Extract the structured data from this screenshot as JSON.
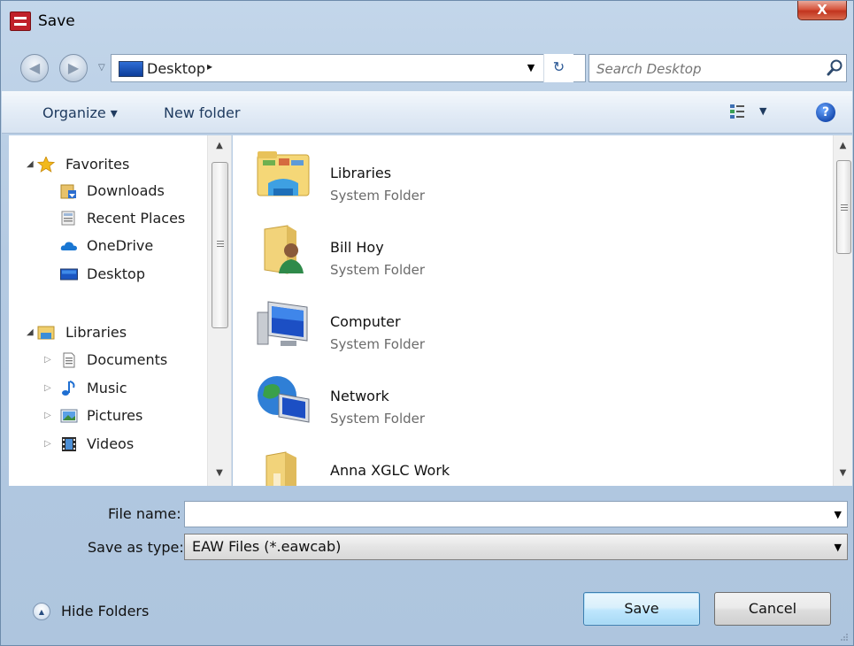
{
  "window": {
    "title": "Save",
    "close_label": "X"
  },
  "address": {
    "location": "Desktop",
    "separator": "▸",
    "back_glyph": "◀",
    "forward_glyph": "▶",
    "refresh_glyph": "↻"
  },
  "search": {
    "placeholder": "Search Desktop"
  },
  "toolbar": {
    "organize_label": "Organize ▾",
    "new_folder_label": "New folder",
    "view_caret": "▼",
    "help_label": "?"
  },
  "nav": {
    "favorites": {
      "label": "Favorites",
      "items": [
        {
          "label": "Downloads",
          "icon": "downloads-icon"
        },
        {
          "label": "Recent Places",
          "icon": "recent-places-icon"
        },
        {
          "label": "OneDrive",
          "icon": "onedrive-icon"
        },
        {
          "label": "Desktop",
          "icon": "desktop-icon"
        }
      ]
    },
    "libraries": {
      "label": "Libraries",
      "items": [
        {
          "label": "Documents",
          "icon": "documents-icon"
        },
        {
          "label": "Music",
          "icon": "music-icon"
        },
        {
          "label": "Pictures",
          "icon": "pictures-icon"
        },
        {
          "label": "Videos",
          "icon": "videos-icon"
        }
      ]
    }
  },
  "files": [
    {
      "name": "Libraries",
      "type": "System Folder",
      "icon": "libraries-folder-icon"
    },
    {
      "name": "Bill Hoy",
      "type": "System Folder",
      "icon": "user-folder-icon"
    },
    {
      "name": "Computer",
      "type": "System Folder",
      "icon": "computer-icon"
    },
    {
      "name": "Network",
      "type": "System Folder",
      "icon": "network-icon"
    },
    {
      "name": "Anna XGLC Work",
      "type": "",
      "icon": "folder-icon"
    }
  ],
  "form": {
    "filename_label": "File name:",
    "filename_value": "",
    "savetype_label": "Save as type:",
    "savetype_value": "EAW Files (*.eawcab)"
  },
  "footer": {
    "hide_folders_label": "Hide Folders",
    "save_label": "Save",
    "cancel_label": "Cancel"
  },
  "colors": {
    "window_frame": "#b9cde2",
    "toolbar_bg": "#e3ecf6",
    "save_button": "#bee6fd",
    "close_button": "#c2341e"
  }
}
